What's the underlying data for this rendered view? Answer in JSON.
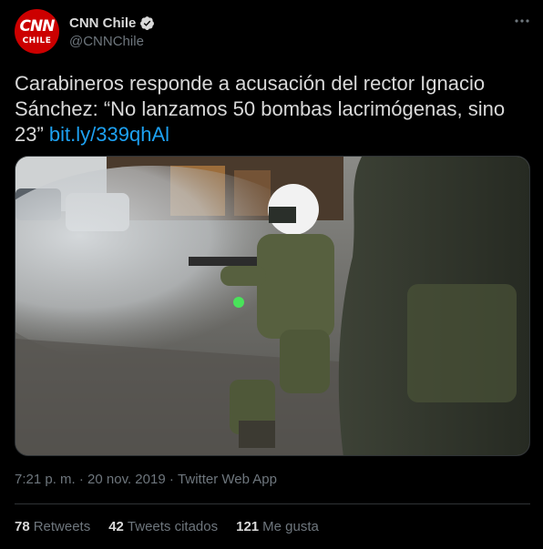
{
  "author": {
    "avatar_top_text": "CNN",
    "avatar_bottom_text": "CHILE",
    "display_name": "CNN Chile",
    "handle": "@CNNChile",
    "verified": true
  },
  "more_menu_icon": "three-dots-icon",
  "tweet": {
    "text_line1": "Carabineros responde a acusación del rector Ignacio",
    "text_line2": "Sánchez: “No lanzamos 50 bombas lacrimógenas, sino",
    "text_line3": "23” ",
    "link": "bit.ly/339qhAl"
  },
  "meta": {
    "time": "7:21 p. m.",
    "separator": " · ",
    "date": "20 nov. 2019",
    "source": "Twitter Web App"
  },
  "stats": {
    "retweets_count": "78",
    "retweets_label": "Retweets",
    "quotes_count": "42",
    "quotes_label": "Tweets citados",
    "likes_count": "121",
    "likes_label": "Me gusta"
  },
  "colors": {
    "background": "#000000",
    "text": "#d9d9d9",
    "secondary": "#6e767d",
    "link": "#1da1f2",
    "divider": "#2f3336",
    "avatar_red": "#cc0000"
  }
}
